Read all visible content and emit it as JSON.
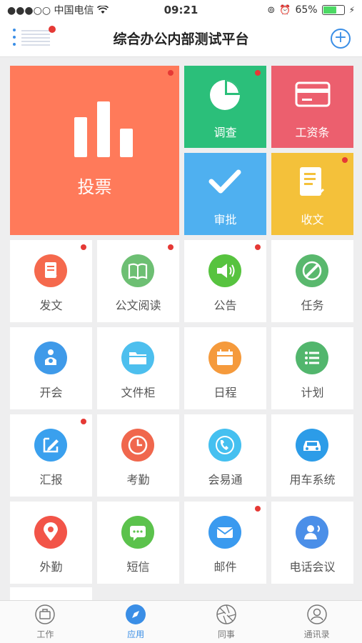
{
  "status": {
    "carrier": "●●●○○ 中国电信",
    "time": "09:21",
    "battery": "65%",
    "battery_level": 0.65
  },
  "header": {
    "title": "综合办公内部测试平台"
  },
  "featured": [
    {
      "label": "投票",
      "color": "#ff7a5a",
      "badge": true
    },
    {
      "label": "调查",
      "color": "#2bbf7a",
      "badge": true
    },
    {
      "label": "工资条",
      "color": "#ec5f6e",
      "badge": false
    },
    {
      "label": "审批",
      "color": "#4fb0f0",
      "badge": false
    },
    {
      "label": "收文",
      "color": "#f4c13a",
      "badge": true
    }
  ],
  "apps": [
    {
      "label": "发文",
      "color": "#f5694d",
      "icon": "document-icon",
      "badge": true
    },
    {
      "label": "公文阅读",
      "color": "#6dbf73",
      "icon": "book-icon",
      "badge": true
    },
    {
      "label": "公告",
      "color": "#57c33f",
      "icon": "speaker-icon",
      "badge": true
    },
    {
      "label": "任务",
      "color": "#59b86d",
      "icon": "task-icon",
      "badge": false
    },
    {
      "label": "开会",
      "color": "#3f9ae9",
      "icon": "meeting-icon",
      "badge": false
    },
    {
      "label": "文件柜",
      "color": "#4dbfee",
      "icon": "folder-icon",
      "badge": false
    },
    {
      "label": "日程",
      "color": "#f59a3c",
      "icon": "calendar-icon",
      "badge": false
    },
    {
      "label": "计划",
      "color": "#52b66d",
      "icon": "list-icon",
      "badge": false
    },
    {
      "label": "汇报",
      "color": "#3aa0ee",
      "icon": "edit-icon",
      "badge": true
    },
    {
      "label": "考勤",
      "color": "#f0674d",
      "icon": "clock-icon",
      "badge": false
    },
    {
      "label": "会易通",
      "color": "#45c0f0",
      "icon": "phone-icon",
      "badge": false
    },
    {
      "label": "用车系统",
      "color": "#2c9ce8",
      "icon": "car-icon",
      "badge": false
    },
    {
      "label": "外勤",
      "color": "#f25448",
      "icon": "location-icon",
      "badge": false
    },
    {
      "label": "短信",
      "color": "#5bc24c",
      "icon": "message-icon",
      "badge": false
    },
    {
      "label": "邮件",
      "color": "#3a9aef",
      "icon": "mail-icon",
      "badge": true
    },
    {
      "label": "电话会议",
      "color": "#4b8fe8",
      "icon": "conference-icon",
      "badge": false
    }
  ],
  "tabs": [
    {
      "label": "工作",
      "icon": "briefcase-icon",
      "active": false
    },
    {
      "label": "应用",
      "icon": "compass-icon",
      "active": true
    },
    {
      "label": "同事",
      "icon": "aperture-icon",
      "active": false
    },
    {
      "label": "通讯录",
      "icon": "contact-icon",
      "active": false
    }
  ]
}
